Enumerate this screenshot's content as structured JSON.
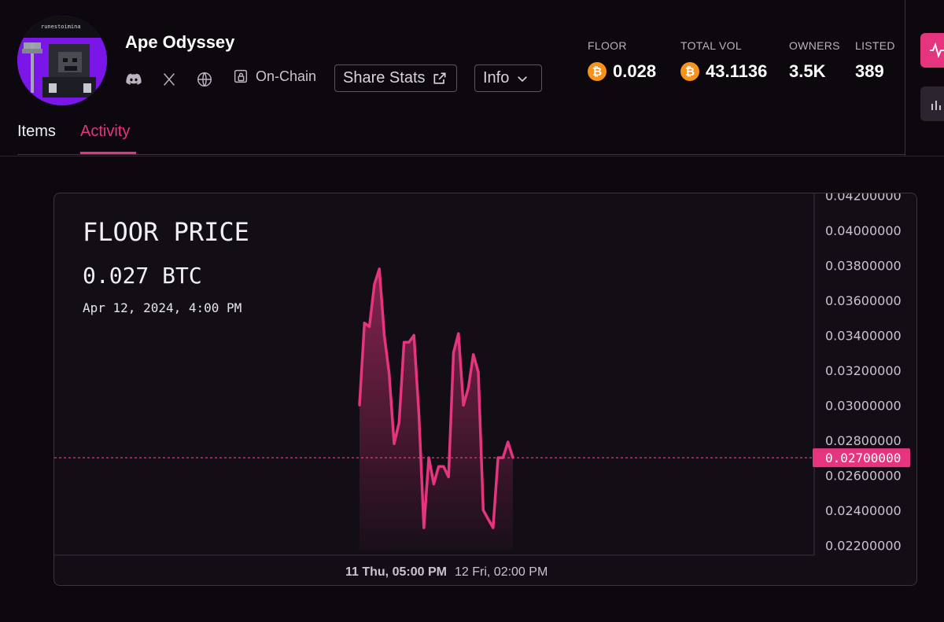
{
  "collection": {
    "name": "Ape Odyssey",
    "avatar_text": "runestoimina"
  },
  "links": {
    "onchain_label": "On-Chain",
    "share_label": "Share Stats",
    "info_label": "Info"
  },
  "stats": {
    "floor_label": "FLOOR",
    "floor_value": "0.028",
    "total_vol_label": "TOTAL VOL",
    "total_vol_value": "43.1136",
    "owners_label": "OWNERS",
    "owners_value": "3.5K",
    "listed_label": "LISTED",
    "listed_value": "389"
  },
  "tabs": [
    {
      "label": "Items",
      "active": false
    },
    {
      "label": "Activity",
      "active": true
    }
  ],
  "colors": {
    "accent": "#e5357e",
    "btc": "#f7931a",
    "background": "#0c080e"
  },
  "chart_data": {
    "type": "area",
    "title": "FLOOR PRICE",
    "headline_value": "0.027 BTC",
    "headline_time": "Apr 12, 2024, 4:00 PM",
    "y_ticks": [
      "0.04200000",
      "0.04000000",
      "0.03800000",
      "0.03600000",
      "0.03400000",
      "0.03200000",
      "0.03000000",
      "0.02800000",
      "0.02600000",
      "0.02400000",
      "0.02200000"
    ],
    "x_ticks": [
      "11 Thu, 05:00 PM",
      "12 Fri, 02:00 PM"
    ],
    "current_price_label": "0.02700000",
    "current_price": 0.027,
    "ylim": [
      0.0217,
      0.0422
    ],
    "grid": false,
    "series": [
      {
        "values": [
          0.03,
          0.0347,
          0.0345,
          0.0369,
          0.0378,
          0.034,
          0.0318,
          0.0278,
          0.029,
          0.0336,
          0.0336,
          0.034,
          0.0295,
          0.023,
          0.027,
          0.0255,
          0.0265,
          0.0265,
          0.0259,
          0.033,
          0.0341,
          0.03,
          0.031,
          0.0329,
          0.0319,
          0.024,
          0.0235,
          0.023,
          0.027,
          0.027,
          0.0279,
          0.027
        ]
      }
    ]
  }
}
